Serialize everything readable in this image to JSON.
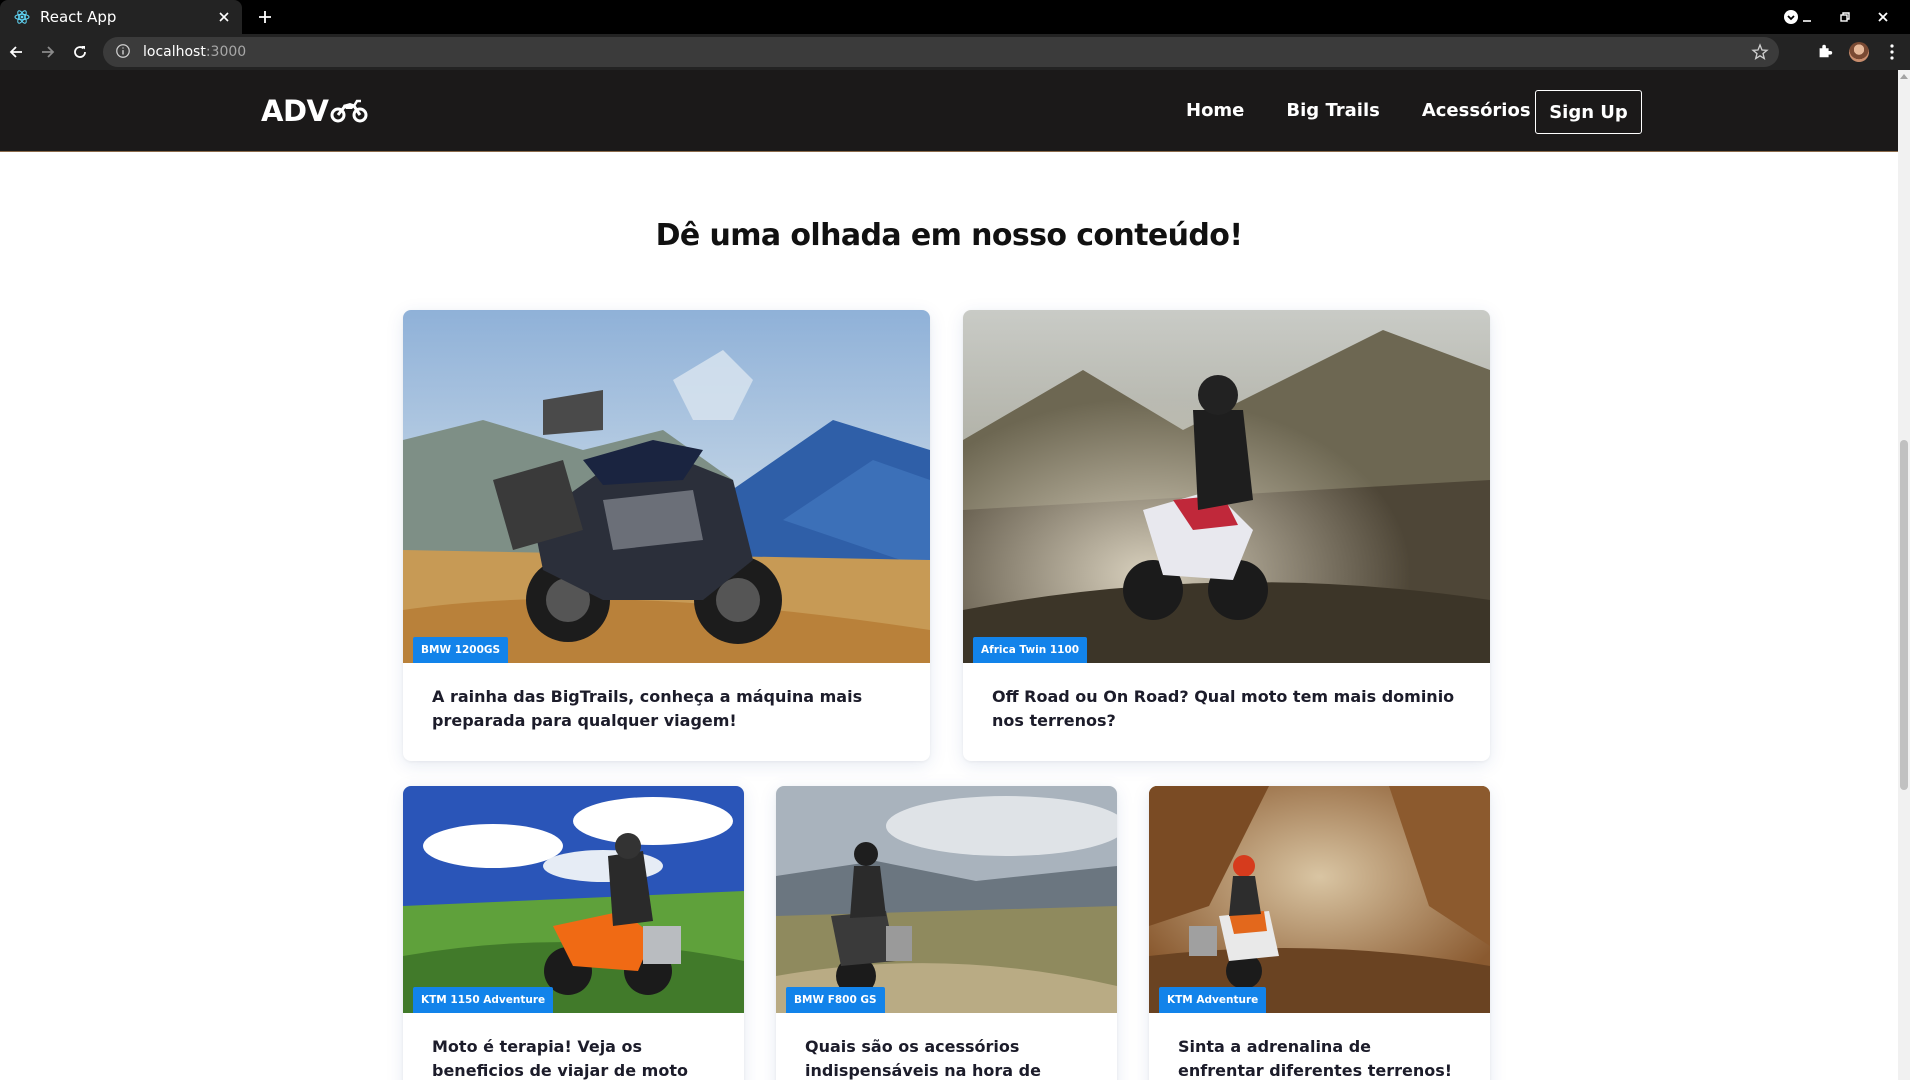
{
  "browser": {
    "tab_title": "React App",
    "url_host": "localhost",
    "url_port": ":3000",
    "icons": [
      "react-favicon",
      "close-icon",
      "plus-icon",
      "minimize-icon",
      "restore-icon",
      "close-window-icon",
      "back-icon",
      "forward-icon",
      "reload-icon",
      "info-icon",
      "star-icon",
      "puzzle-icon",
      "kebab-icon"
    ]
  },
  "header": {
    "logo_text": "ADV",
    "logo_icon": "motorcycle-icon",
    "nav": [
      "Home",
      "Big Trails",
      "Acessórios"
    ],
    "signup_label": "Sign Up"
  },
  "main": {
    "title": "Dê uma olhada em nosso conteúdo!",
    "cards": [
      {
        "badge": "BMW 1200GS",
        "title": "A rainha das BigTrails, conheça a máquina mais preparada para qualquer viagem!"
      },
      {
        "badge": "Africa Twin 1100",
        "title": "Off Road ou On Road? Qual moto tem mais dominio nos terrenos?"
      },
      {
        "badge": "KTM 1150 Adventure",
        "title": "Moto é terapia! Veja os beneficios de viajar de moto"
      },
      {
        "badge": "BMW F800 GS",
        "title": "Quais são os acessórios indispensáveis na hora de viajar?"
      },
      {
        "badge": "KTM Adventure",
        "title": "Sinta a adrenalina de enfrentar diferentes terrenos!"
      }
    ]
  },
  "colors": {
    "header_bg": "#1b1919",
    "badge_bg": "#1283ea",
    "title_text": "#111111"
  }
}
